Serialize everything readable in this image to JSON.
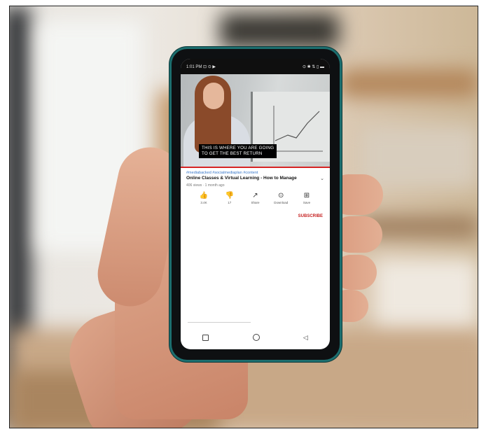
{
  "statusbar": {
    "left": "1:01 PM ⊡ ⊙ ▶",
    "right": "⊙ ✱ ⇅ ▯ ▬"
  },
  "video": {
    "caption_line1": "THIS IS WHERE YOU ARE GOING",
    "caption_line2": "TO GET THE BEST RETURN"
  },
  "info": {
    "hashtags": "#mediabacked #socialmediaplan #content",
    "title": "Online Classes & Virtual Learning - How to Manage",
    "views": "406 views · 1 month ago"
  },
  "actions": [
    {
      "icon": "thumbs-up-icon",
      "glyph": "👍",
      "label": "3.4K"
    },
    {
      "icon": "thumbs-down-icon",
      "glyph": "👎",
      "label": "17"
    },
    {
      "icon": "share-icon",
      "glyph": "↗",
      "label": "Share"
    },
    {
      "icon": "download-icon",
      "glyph": "⊙",
      "label": "Download"
    },
    {
      "icon": "save-icon",
      "glyph": "⊞",
      "label": "Save"
    }
  ],
  "subscribe_label": "SUBSCRIBE",
  "colors": {
    "accent": "#c62222",
    "link": "#3a78c9",
    "phone_rim": "#1c6e6e"
  }
}
